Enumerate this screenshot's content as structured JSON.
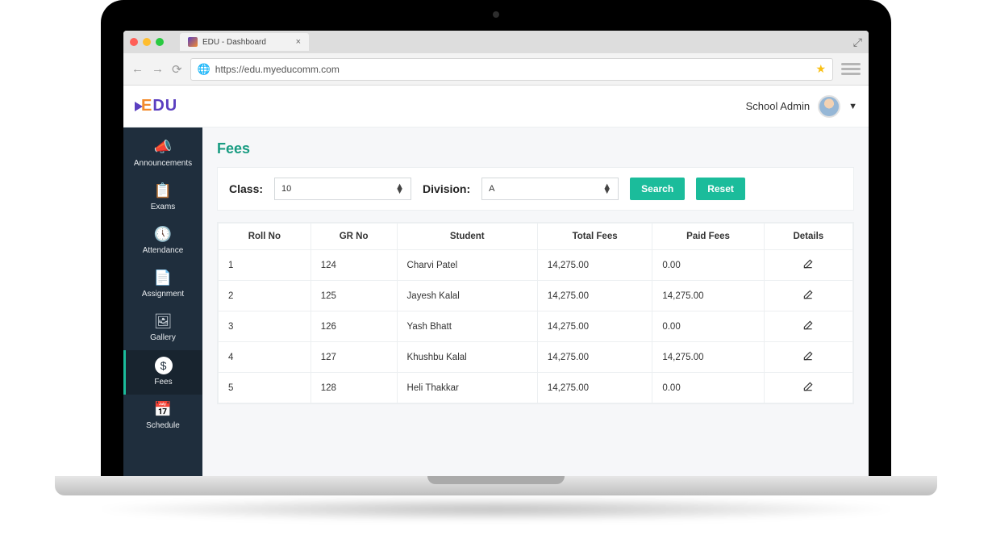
{
  "browser": {
    "tab_title": "EDU - Dashboard",
    "url": "https://edu.myeducomm.com"
  },
  "header": {
    "logo_text_e": "E",
    "logo_text_du": "DU",
    "user_label": "School Admin"
  },
  "sidebar": {
    "items": [
      {
        "label": "Announcements"
      },
      {
        "label": "Exams"
      },
      {
        "label": "Attendance"
      },
      {
        "label": "Assignment"
      },
      {
        "label": "Gallery"
      },
      {
        "label": "Fees"
      },
      {
        "label": "Schedule"
      }
    ]
  },
  "page": {
    "title": "Fees",
    "filters": {
      "class_label": "Class:",
      "class_value": "10",
      "division_label": "Division:",
      "division_value": "A",
      "search_btn": "Search",
      "reset_btn": "Reset"
    },
    "table": {
      "headers": [
        "Roll No",
        "GR No",
        "Student",
        "Total Fees",
        "Paid Fees",
        "Details"
      ],
      "rows": [
        {
          "roll": "1",
          "gr": "124",
          "student": "Charvi Patel",
          "total": "14,275.00",
          "paid": "0.00"
        },
        {
          "roll": "2",
          "gr": "125",
          "student": "Jayesh Kalal",
          "total": "14,275.00",
          "paid": "14,275.00"
        },
        {
          "roll": "3",
          "gr": "126",
          "student": "Yash Bhatt",
          "total": "14,275.00",
          "paid": "0.00"
        },
        {
          "roll": "4",
          "gr": "127",
          "student": "Khushbu Kalal",
          "total": "14,275.00",
          "paid": "14,275.00"
        },
        {
          "roll": "5",
          "gr": "128",
          "student": "Heli Thakkar",
          "total": "14,275.00",
          "paid": "0.00"
        }
      ]
    }
  }
}
